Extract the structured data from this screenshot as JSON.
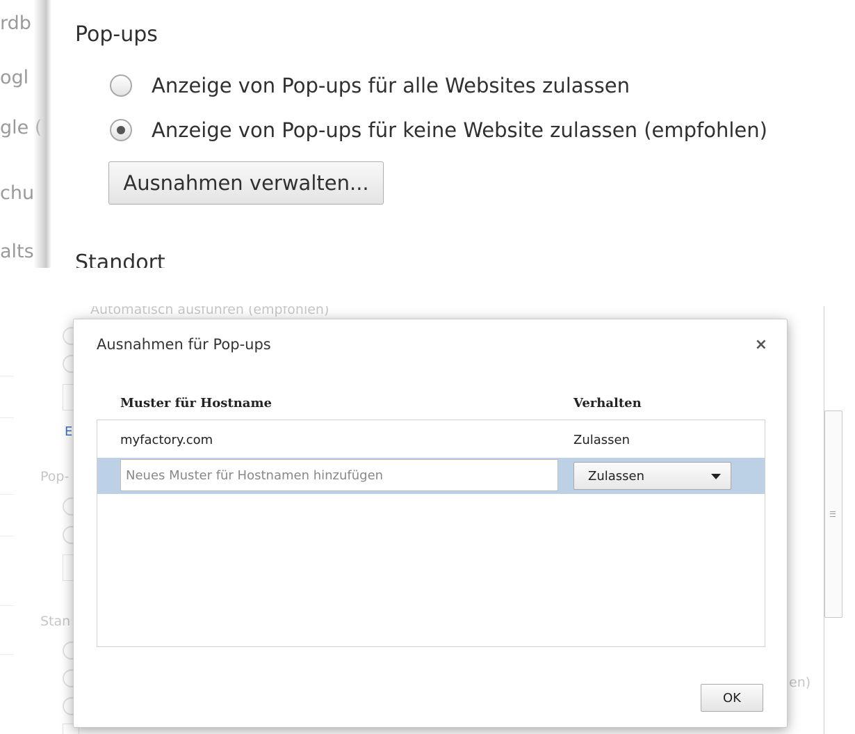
{
  "top": {
    "sidebar_fragments": [
      "rdb",
      "ogl",
      "gle (",
      "chu",
      "alts"
    ],
    "popups_title": "Pop-ups",
    "radio_allow_label": "Anzeige von Pop-ups für alle Websites zulassen",
    "radio_block_label": "Anzeige von Pop-ups für keine Website zulassen (empfohlen)",
    "radio_selected": "block",
    "manage_button_label": "Ausnahmen verwalten...",
    "next_section_title": "Standort"
  },
  "background": {
    "faded_option_text": "Automatisch ausführen (empfohlen)",
    "link_fragment": "Ei",
    "popups_fragment": "Pop-",
    "standort_fragment": "Stan",
    "right_fragment": "en)"
  },
  "dialog": {
    "title": "Ausnahmen für Pop-ups",
    "close_icon": "close-icon",
    "columns": {
      "pattern": "Muster für Hostname",
      "behavior": "Verhalten"
    },
    "rows": [
      {
        "pattern": "myfactory.com",
        "behavior": "Zulassen"
      }
    ],
    "new_row": {
      "placeholder": "Neues Muster für Hostnamen hinzufügen",
      "value": "",
      "behavior_selected": "Zulassen"
    },
    "ok_label": "OK"
  },
  "colors": {
    "selected_row": "#bcd0e6",
    "link": "#3b6fbf"
  }
}
